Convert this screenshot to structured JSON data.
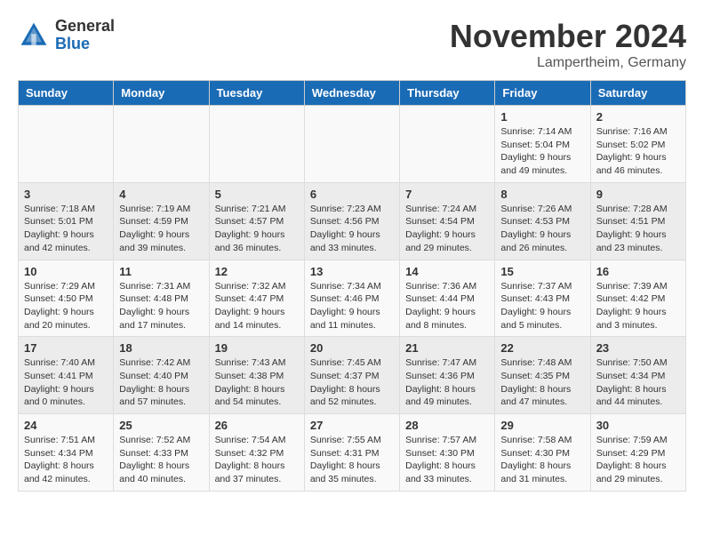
{
  "header": {
    "logo_line1": "General",
    "logo_line2": "Blue",
    "month": "November 2024",
    "location": "Lampertheim, Germany"
  },
  "days_of_week": [
    "Sunday",
    "Monday",
    "Tuesday",
    "Wednesday",
    "Thursday",
    "Friday",
    "Saturday"
  ],
  "weeks": [
    [
      {
        "day": "",
        "info": ""
      },
      {
        "day": "",
        "info": ""
      },
      {
        "day": "",
        "info": ""
      },
      {
        "day": "",
        "info": ""
      },
      {
        "day": "",
        "info": ""
      },
      {
        "day": "1",
        "info": "Sunrise: 7:14 AM\nSunset: 5:04 PM\nDaylight: 9 hours\nand 49 minutes."
      },
      {
        "day": "2",
        "info": "Sunrise: 7:16 AM\nSunset: 5:02 PM\nDaylight: 9 hours\nand 46 minutes."
      }
    ],
    [
      {
        "day": "3",
        "info": "Sunrise: 7:18 AM\nSunset: 5:01 PM\nDaylight: 9 hours\nand 42 minutes."
      },
      {
        "day": "4",
        "info": "Sunrise: 7:19 AM\nSunset: 4:59 PM\nDaylight: 9 hours\nand 39 minutes."
      },
      {
        "day": "5",
        "info": "Sunrise: 7:21 AM\nSunset: 4:57 PM\nDaylight: 9 hours\nand 36 minutes."
      },
      {
        "day": "6",
        "info": "Sunrise: 7:23 AM\nSunset: 4:56 PM\nDaylight: 9 hours\nand 33 minutes."
      },
      {
        "day": "7",
        "info": "Sunrise: 7:24 AM\nSunset: 4:54 PM\nDaylight: 9 hours\nand 29 minutes."
      },
      {
        "day": "8",
        "info": "Sunrise: 7:26 AM\nSunset: 4:53 PM\nDaylight: 9 hours\nand 26 minutes."
      },
      {
        "day": "9",
        "info": "Sunrise: 7:28 AM\nSunset: 4:51 PM\nDaylight: 9 hours\nand 23 minutes."
      }
    ],
    [
      {
        "day": "10",
        "info": "Sunrise: 7:29 AM\nSunset: 4:50 PM\nDaylight: 9 hours\nand 20 minutes."
      },
      {
        "day": "11",
        "info": "Sunrise: 7:31 AM\nSunset: 4:48 PM\nDaylight: 9 hours\nand 17 minutes."
      },
      {
        "day": "12",
        "info": "Sunrise: 7:32 AM\nSunset: 4:47 PM\nDaylight: 9 hours\nand 14 minutes."
      },
      {
        "day": "13",
        "info": "Sunrise: 7:34 AM\nSunset: 4:46 PM\nDaylight: 9 hours\nand 11 minutes."
      },
      {
        "day": "14",
        "info": "Sunrise: 7:36 AM\nSunset: 4:44 PM\nDaylight: 9 hours\nand 8 minutes."
      },
      {
        "day": "15",
        "info": "Sunrise: 7:37 AM\nSunset: 4:43 PM\nDaylight: 9 hours\nand 5 minutes."
      },
      {
        "day": "16",
        "info": "Sunrise: 7:39 AM\nSunset: 4:42 PM\nDaylight: 9 hours\nand 3 minutes."
      }
    ],
    [
      {
        "day": "17",
        "info": "Sunrise: 7:40 AM\nSunset: 4:41 PM\nDaylight: 9 hours\nand 0 minutes."
      },
      {
        "day": "18",
        "info": "Sunrise: 7:42 AM\nSunset: 4:40 PM\nDaylight: 8 hours\nand 57 minutes."
      },
      {
        "day": "19",
        "info": "Sunrise: 7:43 AM\nSunset: 4:38 PM\nDaylight: 8 hours\nand 54 minutes."
      },
      {
        "day": "20",
        "info": "Sunrise: 7:45 AM\nSunset: 4:37 PM\nDaylight: 8 hours\nand 52 minutes."
      },
      {
        "day": "21",
        "info": "Sunrise: 7:47 AM\nSunset: 4:36 PM\nDaylight: 8 hours\nand 49 minutes."
      },
      {
        "day": "22",
        "info": "Sunrise: 7:48 AM\nSunset: 4:35 PM\nDaylight: 8 hours\nand 47 minutes."
      },
      {
        "day": "23",
        "info": "Sunrise: 7:50 AM\nSunset: 4:34 PM\nDaylight: 8 hours\nand 44 minutes."
      }
    ],
    [
      {
        "day": "24",
        "info": "Sunrise: 7:51 AM\nSunset: 4:34 PM\nDaylight: 8 hours\nand 42 minutes."
      },
      {
        "day": "25",
        "info": "Sunrise: 7:52 AM\nSunset: 4:33 PM\nDaylight: 8 hours\nand 40 minutes."
      },
      {
        "day": "26",
        "info": "Sunrise: 7:54 AM\nSunset: 4:32 PM\nDaylight: 8 hours\nand 37 minutes."
      },
      {
        "day": "27",
        "info": "Sunrise: 7:55 AM\nSunset: 4:31 PM\nDaylight: 8 hours\nand 35 minutes."
      },
      {
        "day": "28",
        "info": "Sunrise: 7:57 AM\nSunset: 4:30 PM\nDaylight: 8 hours\nand 33 minutes."
      },
      {
        "day": "29",
        "info": "Sunrise: 7:58 AM\nSunset: 4:30 PM\nDaylight: 8 hours\nand 31 minutes."
      },
      {
        "day": "30",
        "info": "Sunrise: 7:59 AM\nSunset: 4:29 PM\nDaylight: 8 hours\nand 29 minutes."
      }
    ]
  ]
}
